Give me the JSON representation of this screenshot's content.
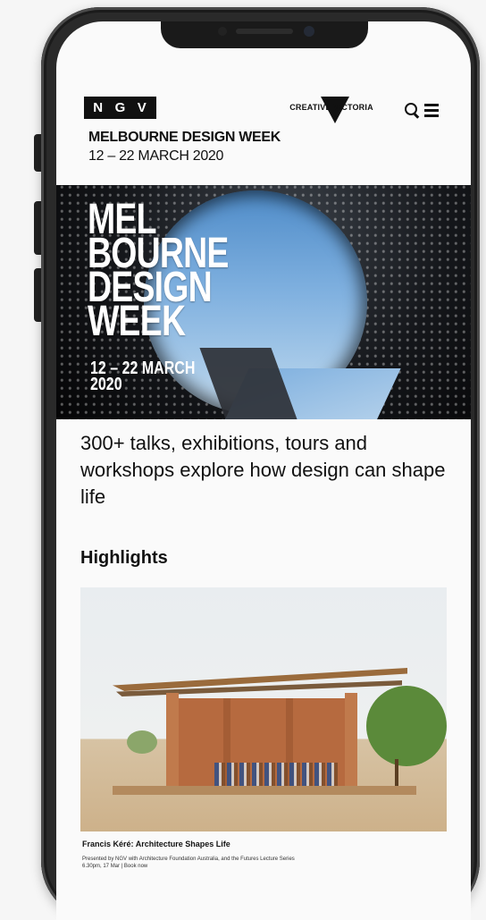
{
  "site": {
    "logo_letters": [
      "N",
      "G",
      "V"
    ],
    "partner_logo": "CREATIVE VICTORIA",
    "title": "MELBOURNE DESIGN WEEK",
    "dates": "12 – 22 MARCH 2020",
    "icons": {
      "search": "search-icon",
      "menu": "hamburger-menu-icon"
    }
  },
  "hero": {
    "lines": [
      "MEL",
      "BOURNE",
      "DESIGN",
      "WEEK"
    ],
    "date_line1": "12 – 22 MARCH",
    "date_line2": "2020"
  },
  "tagline": "300+ talks, exhibitions, tours and workshops explore how design can shape life",
  "highlights": {
    "heading": "Highlights",
    "caption_title": "Francis Kéré: Architecture Shapes Life",
    "caption_body": "Presented by NGV with Architecture Foundation Australia, and the Futures Lecture Series 6.30pm, 17 Mar | Book now"
  },
  "colors": {
    "frame": "#2a2a2a",
    "screen": "#fafafa",
    "text": "#111111"
  }
}
